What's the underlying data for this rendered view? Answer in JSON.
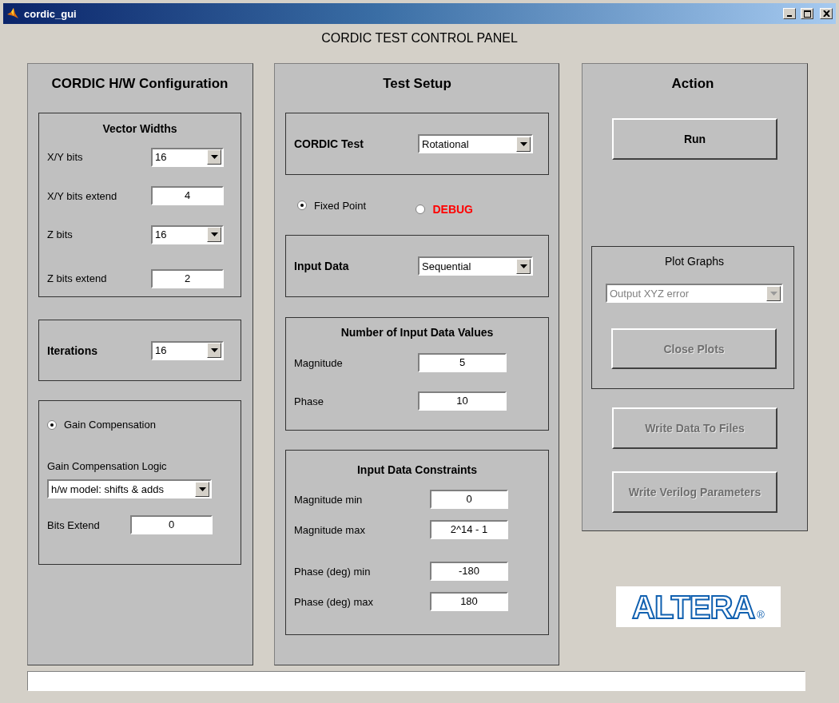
{
  "window": {
    "title": "cordic_gui"
  },
  "heading": "CORDIC TEST CONTROL PANEL",
  "panels": [
    {
      "title": "CORDIC H/W Configuration",
      "sections": [
        {
          "kind": "group",
          "title": "Vector Widths",
          "items": [
            {
              "kind": "dropdown",
              "label": "X/Y bits",
              "value": "16",
              "disabled": false
            },
            {
              "kind": "field",
              "label": "X/Y bits extend",
              "value": "4"
            },
            {
              "kind": "dropdown",
              "label": "Z bits",
              "value": "16",
              "disabled": false
            },
            {
              "kind": "field",
              "label": "Z bits extend",
              "value": "2"
            }
          ]
        },
        {
          "kind": "group",
          "items": [
            {
              "kind": "heading-dropdown",
              "label": "Iterations",
              "value": "16",
              "disabled": false
            }
          ]
        },
        {
          "kind": "group",
          "items": [
            {
              "kind": "radio",
              "label": "Gain Compensation",
              "selected": true
            },
            {
              "kind": "caption",
              "text": "Gain Compensation Logic"
            },
            {
              "kind": "combo",
              "value": "h/w model: shifts & adds",
              "disabled": false
            },
            {
              "kind": "field",
              "label": "Bits Extend",
              "value": "0"
            }
          ]
        }
      ]
    },
    {
      "title": "Test Setup",
      "sections": [
        {
          "kind": "group",
          "items": [
            {
              "kind": "heading-dropdown",
              "label": "CORDIC Test",
              "value": "Rotational",
              "disabled": false
            }
          ]
        },
        {
          "kind": "radios",
          "items": [
            {
              "kind": "radio",
              "label": "Fixed Point",
              "selected": true
            },
            {
              "kind": "alert-radio",
              "label": "DEBUG",
              "selected": false
            }
          ]
        },
        {
          "kind": "group",
          "items": [
            {
              "kind": "heading-dropdown",
              "label": "Input Data",
              "value": "Sequential",
              "disabled": false
            }
          ]
        },
        {
          "kind": "group",
          "title": "Number of Input Data Values",
          "items": [
            {
              "kind": "field",
              "label": "Magnitude",
              "value": "5"
            },
            {
              "kind": "field",
              "label": "Phase",
              "value": "10"
            }
          ]
        },
        {
          "kind": "group",
          "title": "Input Data Constraints",
          "items": [
            {
              "kind": "field",
              "label": "Magnitude min",
              "value": "0"
            },
            {
              "kind": "field",
              "label": "Magnitude max",
              "value": "2^14 - 1"
            },
            {
              "kind": "field",
              "label": "Phase (deg) min",
              "value": "-180"
            },
            {
              "kind": "field",
              "label": "Phase (deg) max",
              "value": "180"
            }
          ]
        }
      ]
    },
    {
      "title": "Action",
      "sections": [
        {
          "kind": "button",
          "label": "Run",
          "disabled": false
        },
        {
          "kind": "group",
          "title": "Plot Graphs",
          "items": [
            {
              "kind": "combo",
              "value": "Output XYZ error",
              "disabled": true
            },
            {
              "kind": "button",
              "label": "Close Plots",
              "disabled": true
            }
          ]
        },
        {
          "kind": "button",
          "label": "Write Data To Files",
          "disabled": true
        },
        {
          "kind": "button",
          "label": "Write Verilog Parameters",
          "disabled": true
        }
      ]
    }
  ],
  "logo": {
    "text": "ALTERA",
    "mark": "®"
  }
}
